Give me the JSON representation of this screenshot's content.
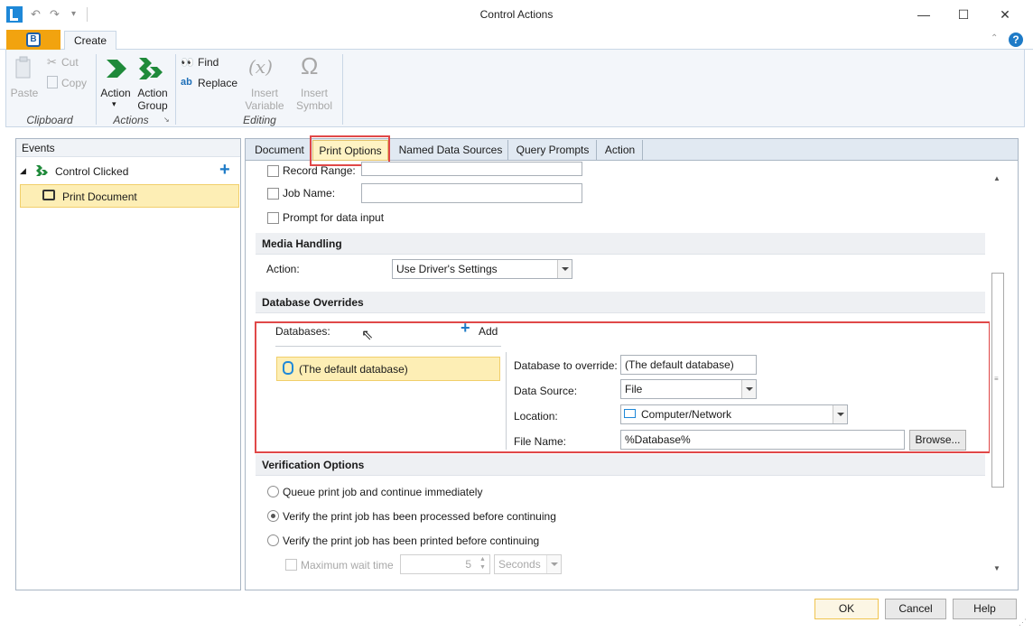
{
  "window": {
    "title": "Control Actions",
    "min_glyph": "—",
    "max_glyph": "☐",
    "close_glyph": "✕"
  },
  "ribbon": {
    "tabs": {
      "create": "Create"
    },
    "clipboard": {
      "paste": "Paste",
      "cut": "Cut",
      "copy": "Copy",
      "group": "Clipboard"
    },
    "actions": {
      "action": "Action",
      "action_group_1": "Action",
      "action_group_2": "Group",
      "group": "Actions"
    },
    "editing": {
      "find": "Find",
      "replace": "Replace",
      "insert_variable_1": "Insert",
      "insert_variable_2": "Variable",
      "insert_symbol_1": "Insert",
      "insert_symbol_2": "Symbol",
      "group": "Editing"
    }
  },
  "events": {
    "header": "Events",
    "event": "Control Clicked",
    "action": "Print Document"
  },
  "tabs": [
    "Document",
    "Print Options",
    "Named Data Sources",
    "Query Prompts",
    "Action"
  ],
  "print_options": {
    "record_range_label": "Record Range:",
    "job_name_label": "Job Name:",
    "job_name_value": "",
    "prompt_label": "Prompt for data input",
    "media_section": "Media Handling",
    "media_action_label": "Action:",
    "media_action_value": "Use Driver's Settings",
    "db_section": "Database Overrides",
    "databases_label": "Databases:",
    "add_label": "Add",
    "db_item": "(The default database)",
    "db_override_label": "Database to override:",
    "db_override_value": "(The default database)",
    "data_source_label": "Data Source:",
    "data_source_value": "File",
    "location_label": "Location:",
    "location_value": "Computer/Network",
    "file_name_label": "File Name:",
    "file_name_value": "%Database%",
    "browse_label": "Browse...",
    "verification_section": "Verification Options",
    "verify_options": [
      "Queue print job and continue immediately",
      "Verify the print job has been processed before continuing",
      "Verify the print job has been printed before continuing"
    ],
    "verify_selected_index": 1,
    "max_wait_label": "Maximum wait time",
    "max_wait_value": "5",
    "max_wait_unit": "Seconds"
  },
  "footer": {
    "ok": "OK",
    "cancel": "Cancel",
    "help": "Help"
  },
  "colors": {
    "highlight_red": "#e04848",
    "selected_yellow": "#fdeeb5",
    "accent_blue": "#1e88d8",
    "green": "#1f8a3a"
  }
}
